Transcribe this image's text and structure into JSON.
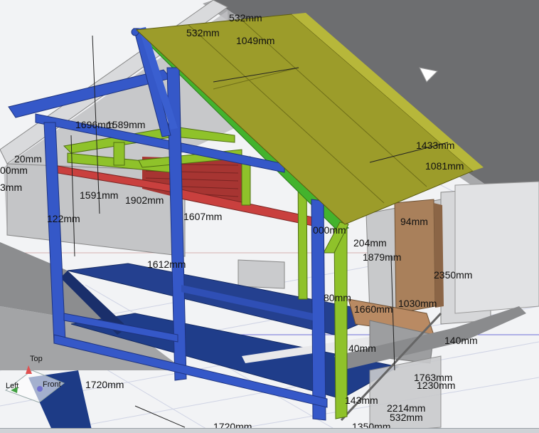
{
  "viewcube": {
    "top": "Top",
    "left": "Left",
    "front": "Front"
  },
  "dimensions": [
    "532mm",
    "532mm",
    "1049mm",
    "1696mm",
    "1589mm",
    "1433mm",
    "1081mm",
    "20mm",
    "00mm",
    "3mm",
    "1591mm",
    "1902mm",
    "1607mm",
    "122mm",
    "1612mm",
    "000mm",
    "204mm",
    "1879mm",
    "94mm",
    "2350mm",
    "80mm",
    "1660mm",
    "1030mm",
    "140mm",
    "40mm",
    "1763mm",
    "1230mm",
    "143mm",
    "2214mm",
    "532mm",
    "1720mm",
    "1720mm",
    "1350mm"
  ],
  "colors": {
    "sky": "#f2f3f5",
    "roof_dark": "#6f7072",
    "roof_panel": "#9c9c2a",
    "frame_blue": "#3558c8",
    "frame_green": "#8fc22a",
    "beam_red": "#c9403e",
    "deck_blue": "#1f3d8a",
    "wall_grey": "#c7c8ca",
    "door_brown": "#a9805b"
  }
}
